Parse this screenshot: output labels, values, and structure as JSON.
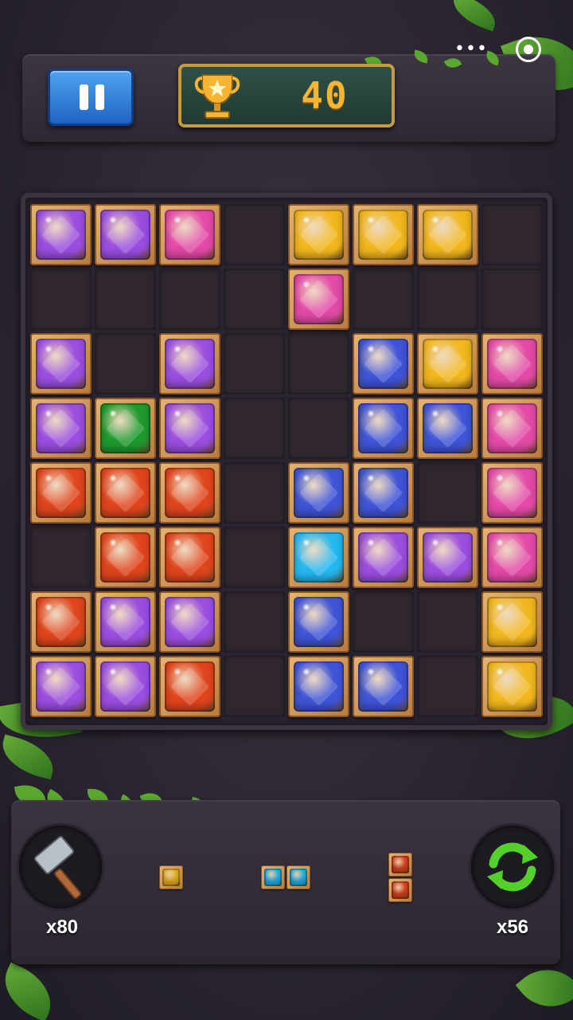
{
  "header": {
    "score": "40",
    "menu_glyph": "•••"
  },
  "colors": {
    "purple": "#9b4ee0",
    "pink": "#e44aa8",
    "yellow": "#f2b71d",
    "blue": "#3f54d8",
    "green": "#1e9a2c",
    "orange": "#e0451c",
    "cyan": "#24b8f0"
  },
  "board": {
    "rows": [
      [
        "purple",
        "purple",
        "pink",
        null,
        "yellow",
        "yellow",
        "yellow",
        null
      ],
      [
        null,
        null,
        null,
        null,
        "pink",
        null,
        null,
        null
      ],
      [
        "purple",
        null,
        "purple",
        null,
        null,
        "blue",
        "yellow",
        "pink"
      ],
      [
        "purple",
        "green",
        "purple",
        null,
        null,
        "blue",
        "blue",
        "pink"
      ],
      [
        "orange",
        "orange",
        "orange",
        null,
        "blue",
        "blue",
        null,
        "pink"
      ],
      [
        null,
        "orange",
        "orange",
        null,
        "cyan",
        "purple",
        "purple",
        "pink"
      ],
      [
        "orange",
        "purple",
        "purple",
        null,
        "blue",
        null,
        null,
        "yellow"
      ],
      [
        "purple",
        "purple",
        "orange",
        null,
        "blue",
        "blue",
        null,
        "yellow"
      ]
    ]
  },
  "tools": {
    "hammer_count": "x80",
    "refresh_count": "x56",
    "hammer_icon": "hammer-icon",
    "refresh_icon": "refresh-icon"
  },
  "pieces": [
    {
      "cells": [
        [
          "yellow"
        ]
      ]
    },
    {
      "cells": [
        [
          "cyan",
          "cyan"
        ]
      ]
    },
    {
      "cells": [
        [
          "orange"
        ],
        [
          "orange"
        ]
      ]
    }
  ]
}
